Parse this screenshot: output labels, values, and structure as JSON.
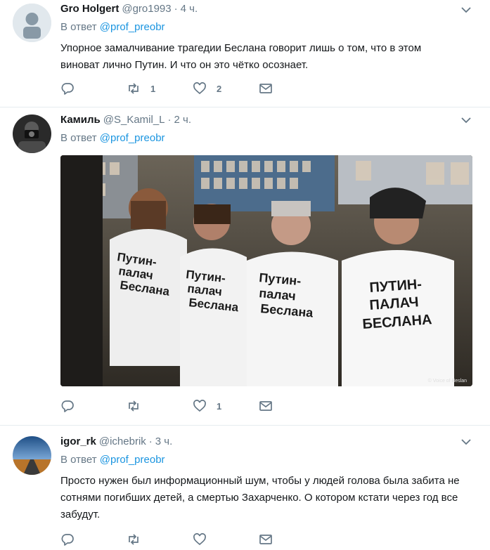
{
  "tweets": [
    {
      "name": "Gro Holgert",
      "handle": "@gro1993",
      "dot": "·",
      "time": "4 ч.",
      "reply_prefix": "В ответ",
      "reply_to": "@prof_preobr",
      "text": "Упорное замалчивание трагедии Беслана говорит лишь о том, что в этом виноват лично Путин. И что он это чётко осознает.",
      "reply_count": "",
      "retweet_count": "1",
      "like_count": "2"
    },
    {
      "name": "Камиль",
      "handle": "@S_Kamil_L",
      "dot": "·",
      "time": "2 ч.",
      "reply_prefix": "В ответ",
      "reply_to": "@prof_preobr",
      "media_shirt_text_1": "Путин-палач Беслана",
      "media_credit": "© Voice of Beslan",
      "reply_count": "",
      "retweet_count": "",
      "like_count": "1"
    },
    {
      "name": "igor_rk",
      "handle": "@ichebrik",
      "dot": "·",
      "time": "3 ч.",
      "reply_prefix": "В ответ",
      "reply_to": "@prof_preobr",
      "text": "Просто нужен был информационный шум, чтобы у людей голова была забита не сотнями погибших детей, а смертью Захарченко. О котором кстати через год все забудут.",
      "reply_count": "",
      "retweet_count": "",
      "like_count": ""
    }
  ],
  "colors": {
    "link": "#1b95e0",
    "muted": "#657786",
    "text": "#14171a"
  }
}
